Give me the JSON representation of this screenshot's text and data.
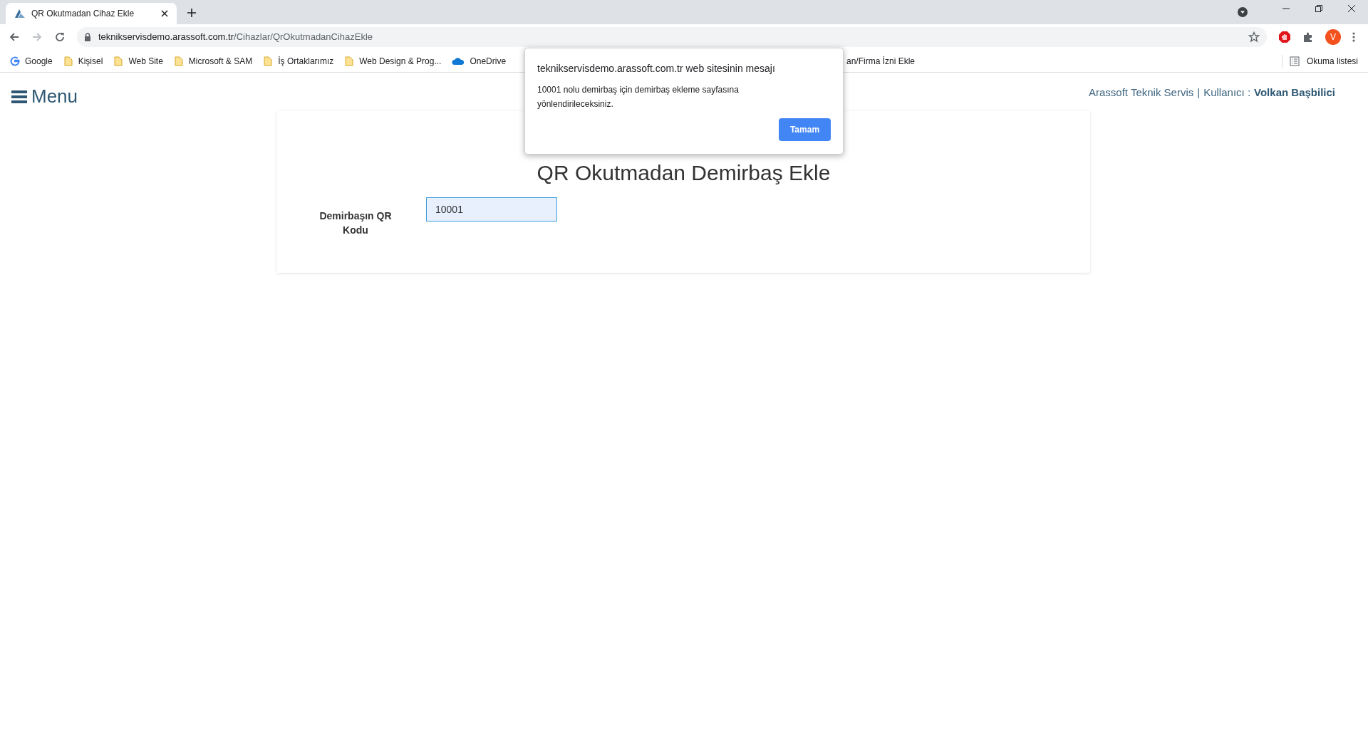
{
  "browser": {
    "tab": {
      "title": "QR Okutmadan Cihaz Ekle",
      "selected": true
    },
    "address": {
      "host": "teknikservisdemo.arassoft.com.tr",
      "path": "/Cihazlar/QrOkutmadanCihazEkle"
    },
    "profile_initial": "V",
    "bookmarks": [
      {
        "label": "Google",
        "kind": "google"
      },
      {
        "label": "Kişisel",
        "kind": "folder"
      },
      {
        "label": "Web Site",
        "kind": "folder"
      },
      {
        "label": "Microsoft & SAM",
        "kind": "folder"
      },
      {
        "label": "İş Ortaklarımız",
        "kind": "folder"
      },
      {
        "label": "Web Design & Prog...",
        "kind": "folder"
      },
      {
        "label": "OneDrive",
        "kind": "cloud"
      },
      {
        "label": "an/Firma İzni Ekle",
        "kind": "partial"
      }
    ],
    "reading_list": "Okuma listesi"
  },
  "header": {
    "menu": "Menu",
    "company": "Arassoft Teknik Servis",
    "separator": "|",
    "user_label": "Kullanıcı :",
    "user_name": "Volkan Başbilici"
  },
  "form": {
    "title": "QR Okutmadan Demirbaş Ekle",
    "field_label": "Demirbaşın QR Kodu",
    "field_value": "10001"
  },
  "dialog": {
    "title": "teknikservisdemo.arassoft.com.tr web sitesinin mesajı",
    "message": "10001 nolu demirbaş için demirbaş ekleme sayfasına yönlendirileceksiniz.",
    "button": "Tamam"
  }
}
